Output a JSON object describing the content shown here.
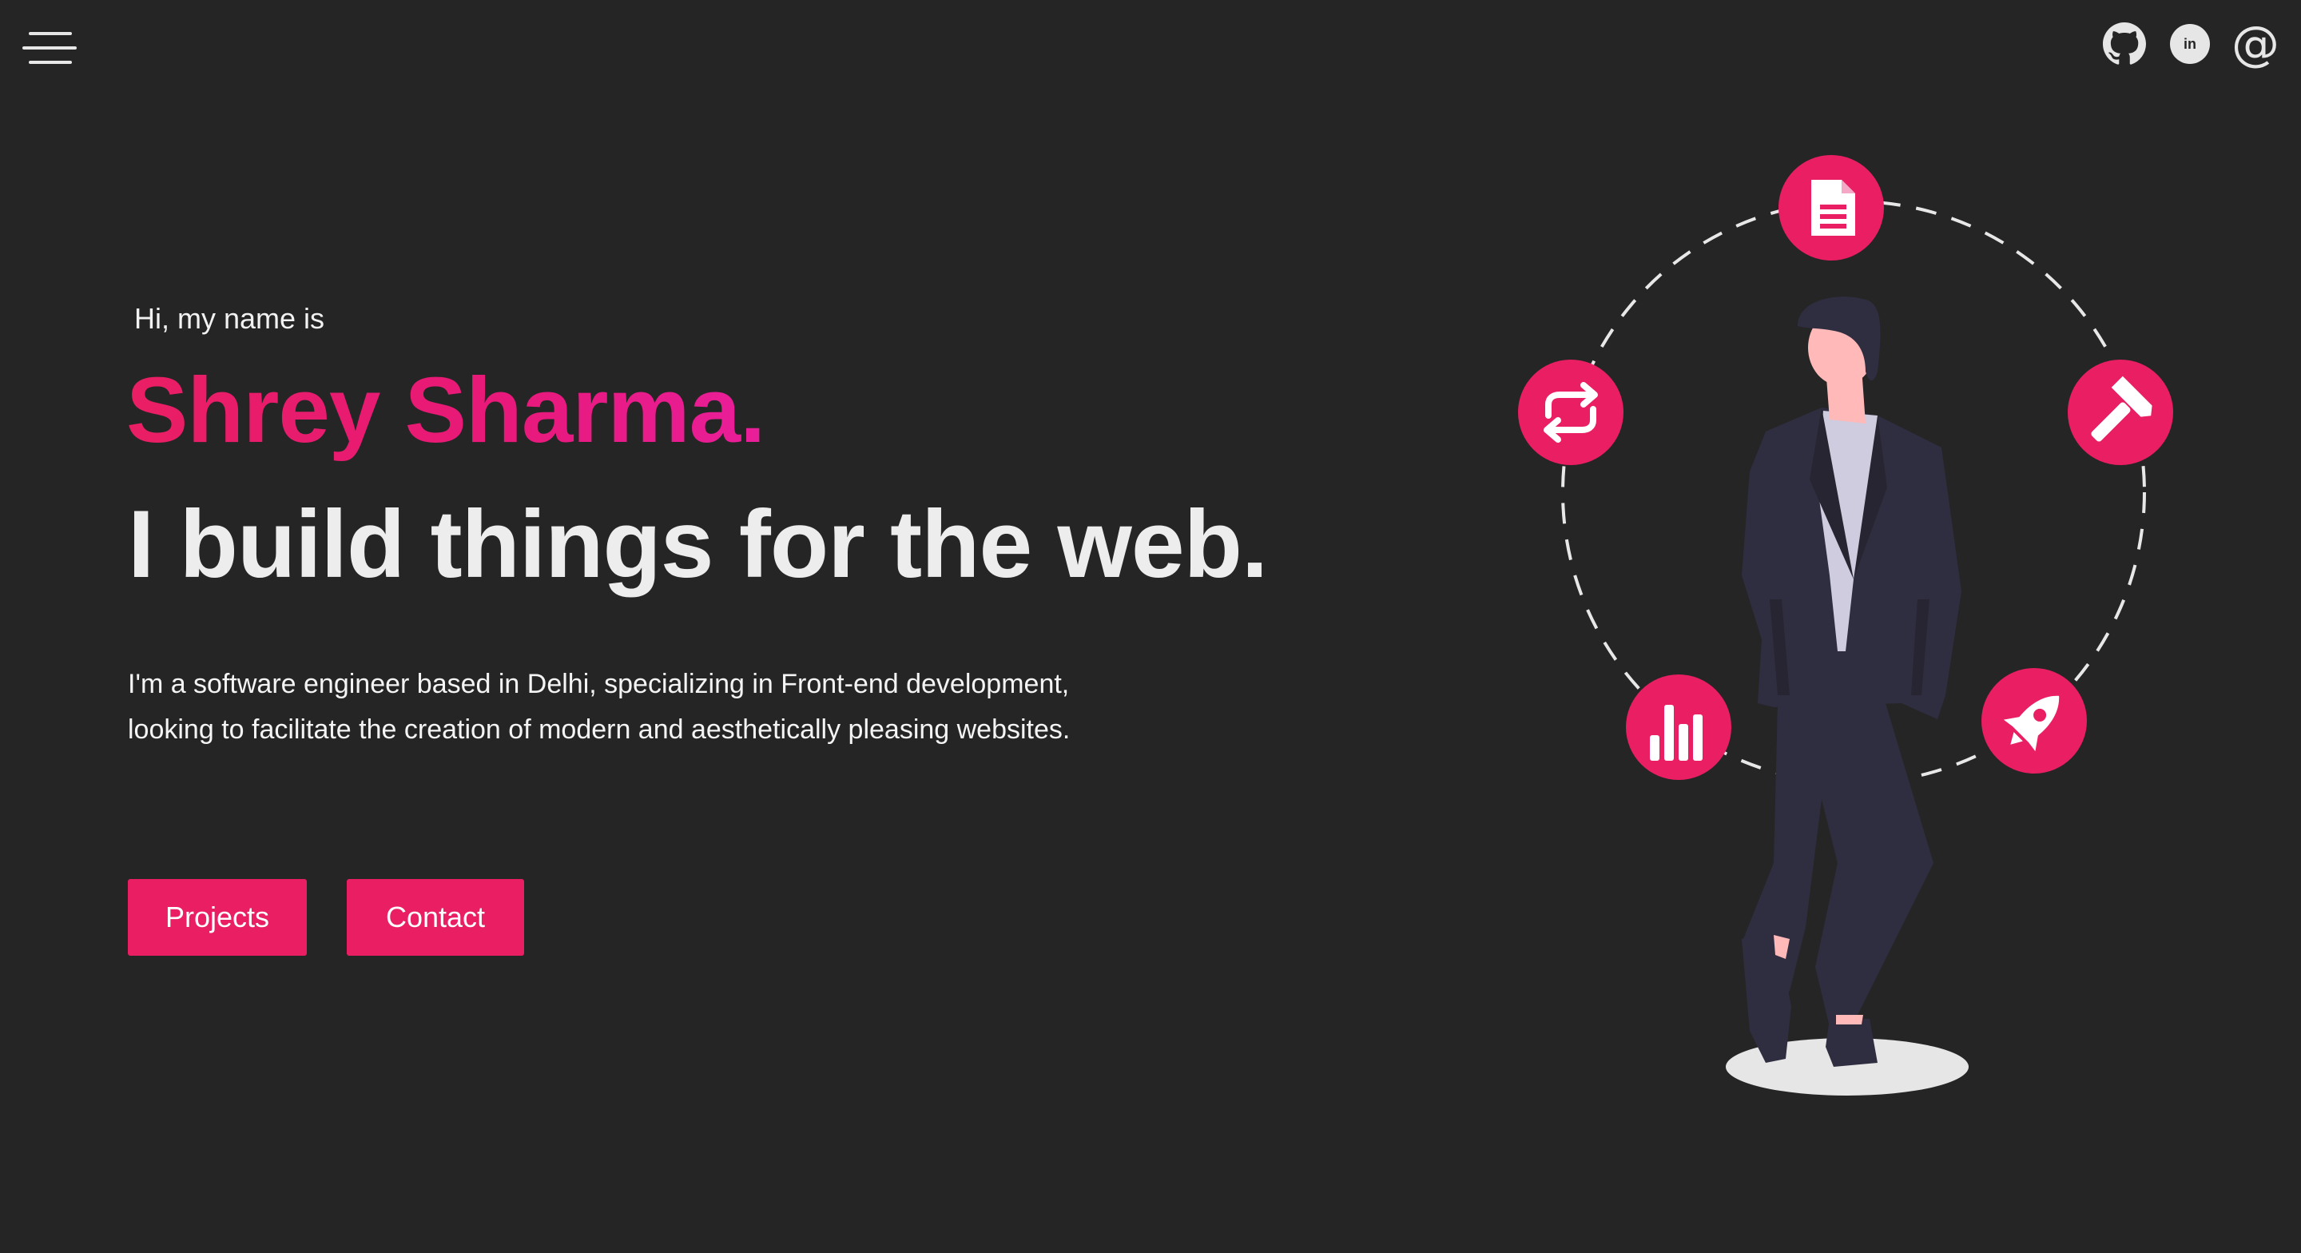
{
  "nav": {
    "menu_icon": "hamburger-menu-icon",
    "socials": [
      {
        "name": "GitHub",
        "icon": "github-icon"
      },
      {
        "name": "LinkedIn",
        "icon": "linkedin-icon",
        "glyph": "in"
      },
      {
        "name": "Email",
        "icon": "at-icon",
        "glyph": "@"
      }
    ]
  },
  "hero": {
    "greeting": "Hi, my name is",
    "name": "Shrey Sharma.",
    "tagline": "I build things for the web.",
    "description": "I'm a software engineer based in Delhi, specializing in Front-end development, looking to facilitate the creation of modern and aesthetically pleasing websites.",
    "buttons": {
      "projects": "Projects",
      "contact": "Contact"
    }
  },
  "illustration": {
    "orbit_icons": [
      "document-icon",
      "hammer-icon",
      "rocket-icon",
      "bar-chart-icon",
      "repeat-icon"
    ]
  },
  "colors": {
    "background": "#252525",
    "accent": "#e91e63",
    "text": "#ededed"
  }
}
